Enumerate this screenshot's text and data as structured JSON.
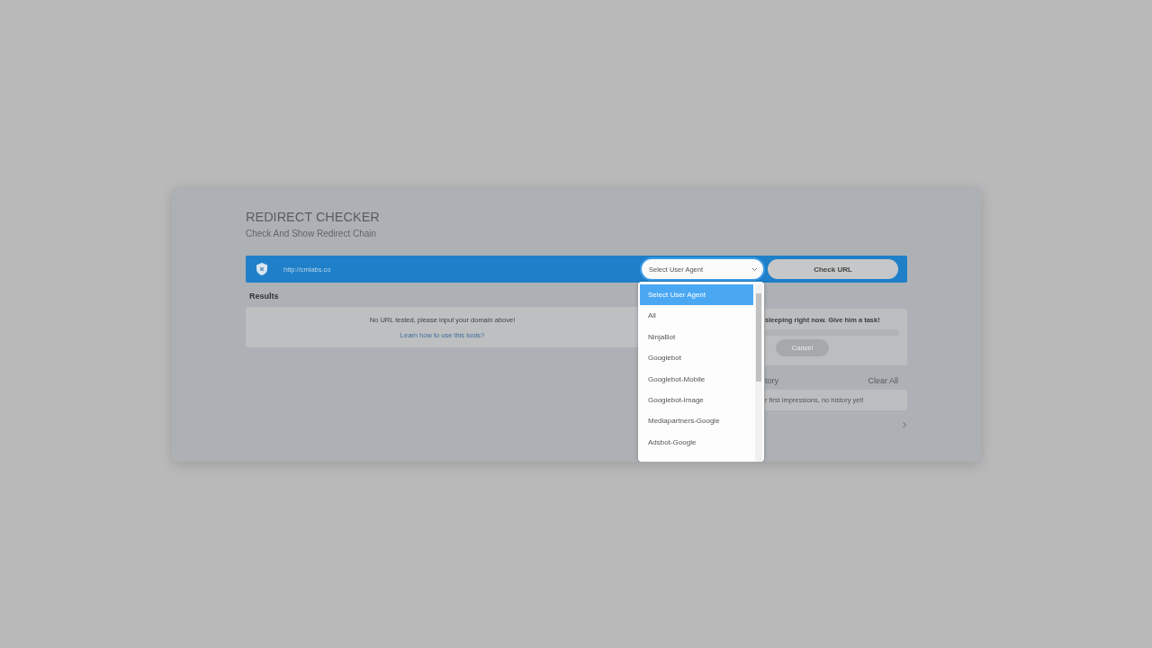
{
  "header": {
    "title": "REDIRECT CHECKER",
    "subtitle": "Check And Show Redirect Chain"
  },
  "url_bar": {
    "value": "http://cmlabs.co",
    "select": {
      "value": "Select User Agent",
      "expanded": true
    },
    "check_button": "Check URL"
  },
  "user_agent_options": [
    {
      "label": "Select User Agent",
      "selected": true
    },
    {
      "label": "All",
      "selected": false
    },
    {
      "label": "NinjaBot",
      "selected": false
    },
    {
      "label": "Googlebot",
      "selected": false
    },
    {
      "label": "Googlebot-Mobile",
      "selected": false
    },
    {
      "label": "Googlebot-Image",
      "selected": false
    },
    {
      "label": "Mediapartners-Google",
      "selected": false
    },
    {
      "label": "Adsbot-Google",
      "selected": false
    }
  ],
  "results": {
    "heading": "Results",
    "message": "No URL tested, please input your domain above!",
    "link": "Learn how to use this tools?"
  },
  "status_panel": {
    "message": "sleeping right now. Give him a task!",
    "level": 0,
    "button": "Cancel",
    "button_disabled": true
  },
  "history": {
    "heading": "tory",
    "clear": "Clear All",
    "empty": "r first impressions, no history yet!"
  }
}
